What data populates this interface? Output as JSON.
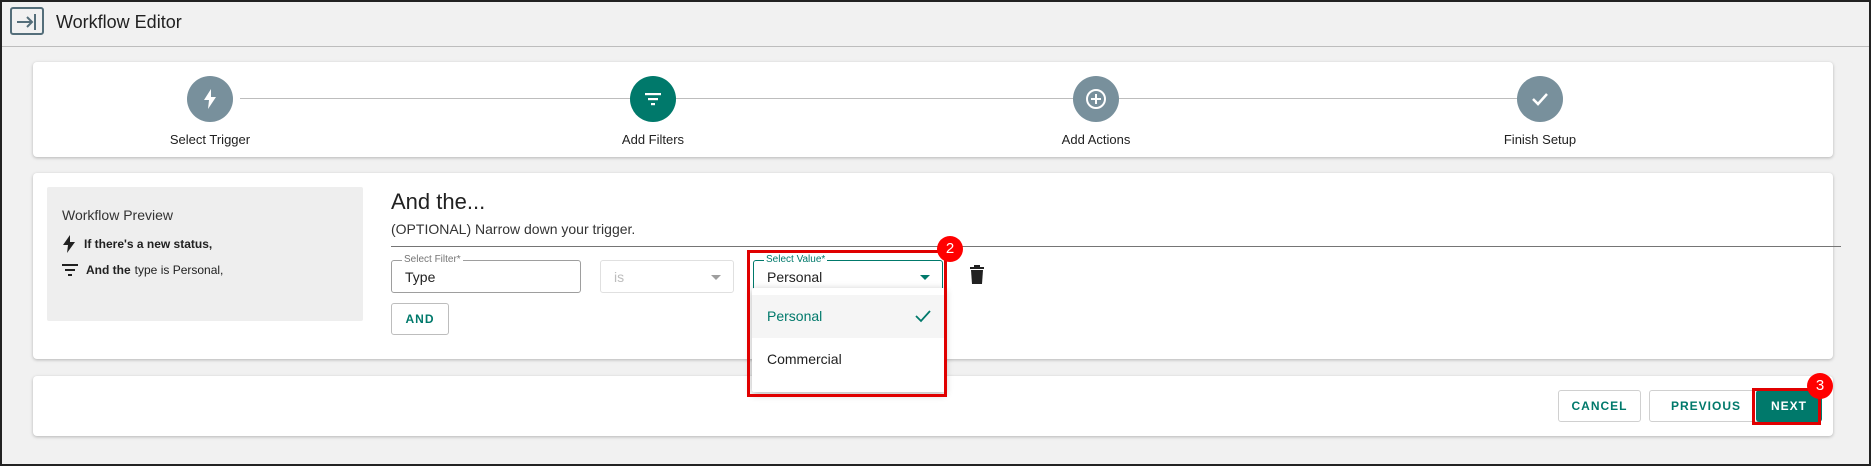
{
  "header": {
    "title": "Workflow Editor",
    "back_icon": "exit-arrow-icon"
  },
  "stepper": {
    "steps": [
      {
        "label": "Select Trigger",
        "icon": "lightning-icon",
        "state": "done"
      },
      {
        "label": "Add Filters",
        "icon": "filter-icon",
        "state": "active"
      },
      {
        "label": "Add Actions",
        "icon": "plus-circle-icon",
        "state": "pending"
      },
      {
        "label": "Finish Setup",
        "icon": "check-icon",
        "state": "pending"
      }
    ]
  },
  "preview": {
    "title": "Workflow Preview",
    "trigger_text": "If there's a new status,",
    "filter_bold": "And the",
    "filter_rest": "type is Personal,"
  },
  "filters": {
    "title": "And the...",
    "subtitle": "(OPTIONAL) Narrow down your trigger.",
    "select_filter": {
      "label": "Select Filter*",
      "value": "Type"
    },
    "operator": {
      "value": "is"
    },
    "select_value": {
      "label": "Select Value*",
      "value": "Personal"
    },
    "and_button": "AND",
    "dropdown_options": [
      {
        "label": "Personal",
        "selected": true
      },
      {
        "label": "Commercial",
        "selected": false
      }
    ]
  },
  "footer": {
    "cancel": "CANCEL",
    "previous": "PREVIOUS",
    "next": "NEXT"
  },
  "annotations": {
    "badge_2": "2",
    "badge_3": "3"
  },
  "colors": {
    "accent": "#00796b",
    "step_inactive": "#78909c",
    "highlight": "#e00000"
  }
}
